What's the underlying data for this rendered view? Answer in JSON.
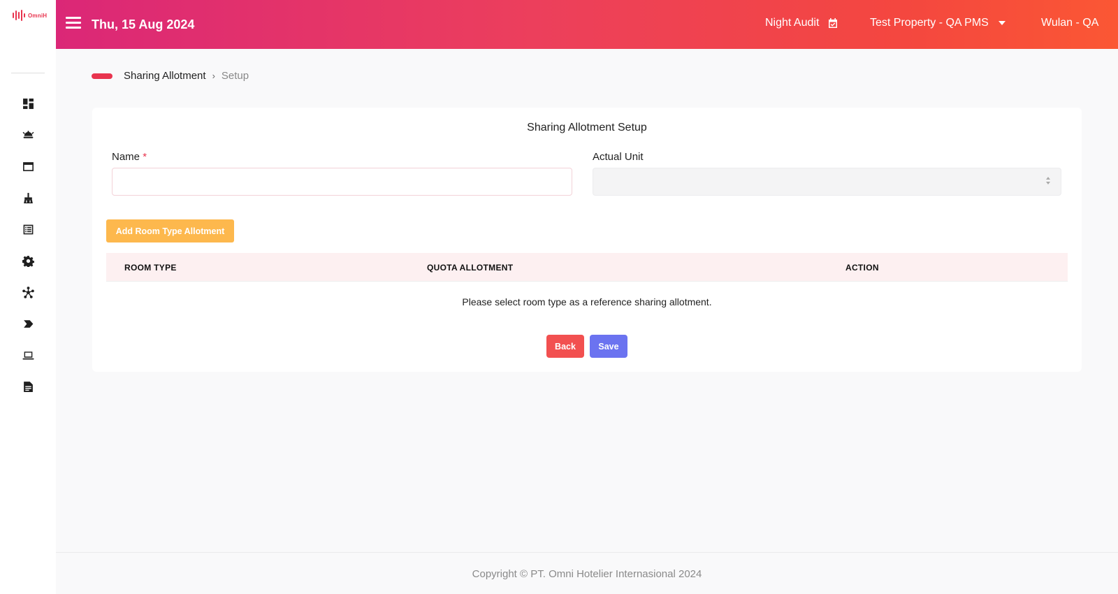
{
  "app": {
    "logo_text": "OmniH"
  },
  "topbar": {
    "date": "Thu, 15 Aug 2024",
    "night_audit": "Night Audit",
    "property": "Test Property - QA PMS",
    "user": "Wulan - QA",
    "gradient": [
      "#db2777",
      "#fb5734"
    ]
  },
  "sidebar": {
    "icons": [
      "dashboard-icon",
      "concierge-bell-icon",
      "window-icon",
      "broom-icon",
      "list-icon",
      "gear-icon",
      "network-icon",
      "tag-icon",
      "laptop-icon",
      "report-icon"
    ]
  },
  "breadcrumb": {
    "parent": "Sharing Allotment",
    "separator": "›",
    "current": "Setup"
  },
  "form": {
    "title": "Sharing Allotment Setup",
    "name_label": "Name",
    "required_mark": "*",
    "name_value": "",
    "actual_unit_label": "Actual Unit",
    "actual_unit_value": "",
    "add_button": "Add Room Type Allotment"
  },
  "table": {
    "columns": [
      "ROOM TYPE",
      "QUOTA ALLOTMENT",
      "ACTION"
    ],
    "empty_message": "Please select room type as a reference sharing allotment."
  },
  "actions": {
    "back": "Back",
    "save": "Save"
  },
  "footer": {
    "copyright": "Copyright © PT. Omni Hotelier Internasional 2024"
  },
  "colors": {
    "accent": "#e8344e",
    "add_button": "#fdb84d",
    "back_button": "#f25050",
    "save_button": "#6b73f0"
  }
}
